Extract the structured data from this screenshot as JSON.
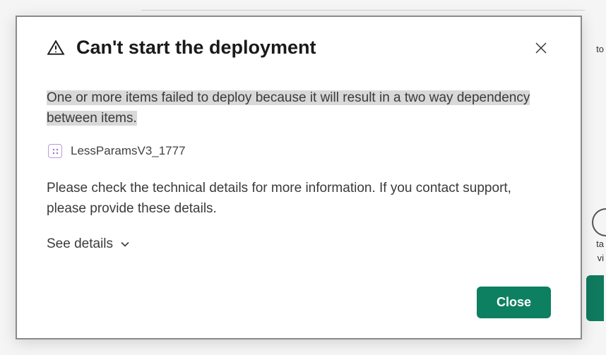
{
  "dialog": {
    "title": "Can't start the deployment",
    "error_message": "One or more items failed to deploy because it will result in a two way dependency between items.",
    "item_name": "LessParamsV3_1777",
    "support_text": "Please check the technical details for more information. If you contact support, please provide these details.",
    "see_details_label": "See details",
    "close_button_label": "Close"
  },
  "background": {
    "text_top_right": "to",
    "text_mid_right1": "ta",
    "text_mid_right2": "vi"
  }
}
